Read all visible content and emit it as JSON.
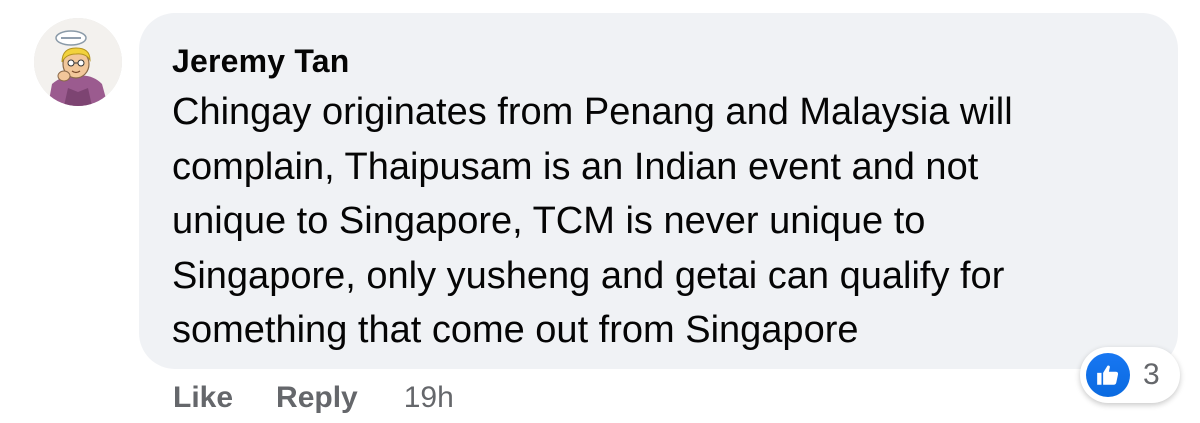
{
  "comment": {
    "author": "Jeremy Tan",
    "lines": [
      "Chingay originates from Penang and Malaysia will",
      "complain, Thaipusam is an Indian event and not",
      "unique to Singapore, TCM is never unique to",
      "Singapore, only yusheng and getai can qualify for",
      "something that come out from Singapore"
    ],
    "avatar_icon": "cartoon-portrait-avatar"
  },
  "actions": {
    "like_label": "Like",
    "reply_label": "Reply",
    "timestamp": "19h"
  },
  "reactions": {
    "icon": "thumbs-up-icon",
    "count": "3",
    "color": "#1877f2"
  },
  "colors": {
    "bubble": "#f0f2f5",
    "text": "#050505",
    "secondary_text": "#65676b"
  }
}
